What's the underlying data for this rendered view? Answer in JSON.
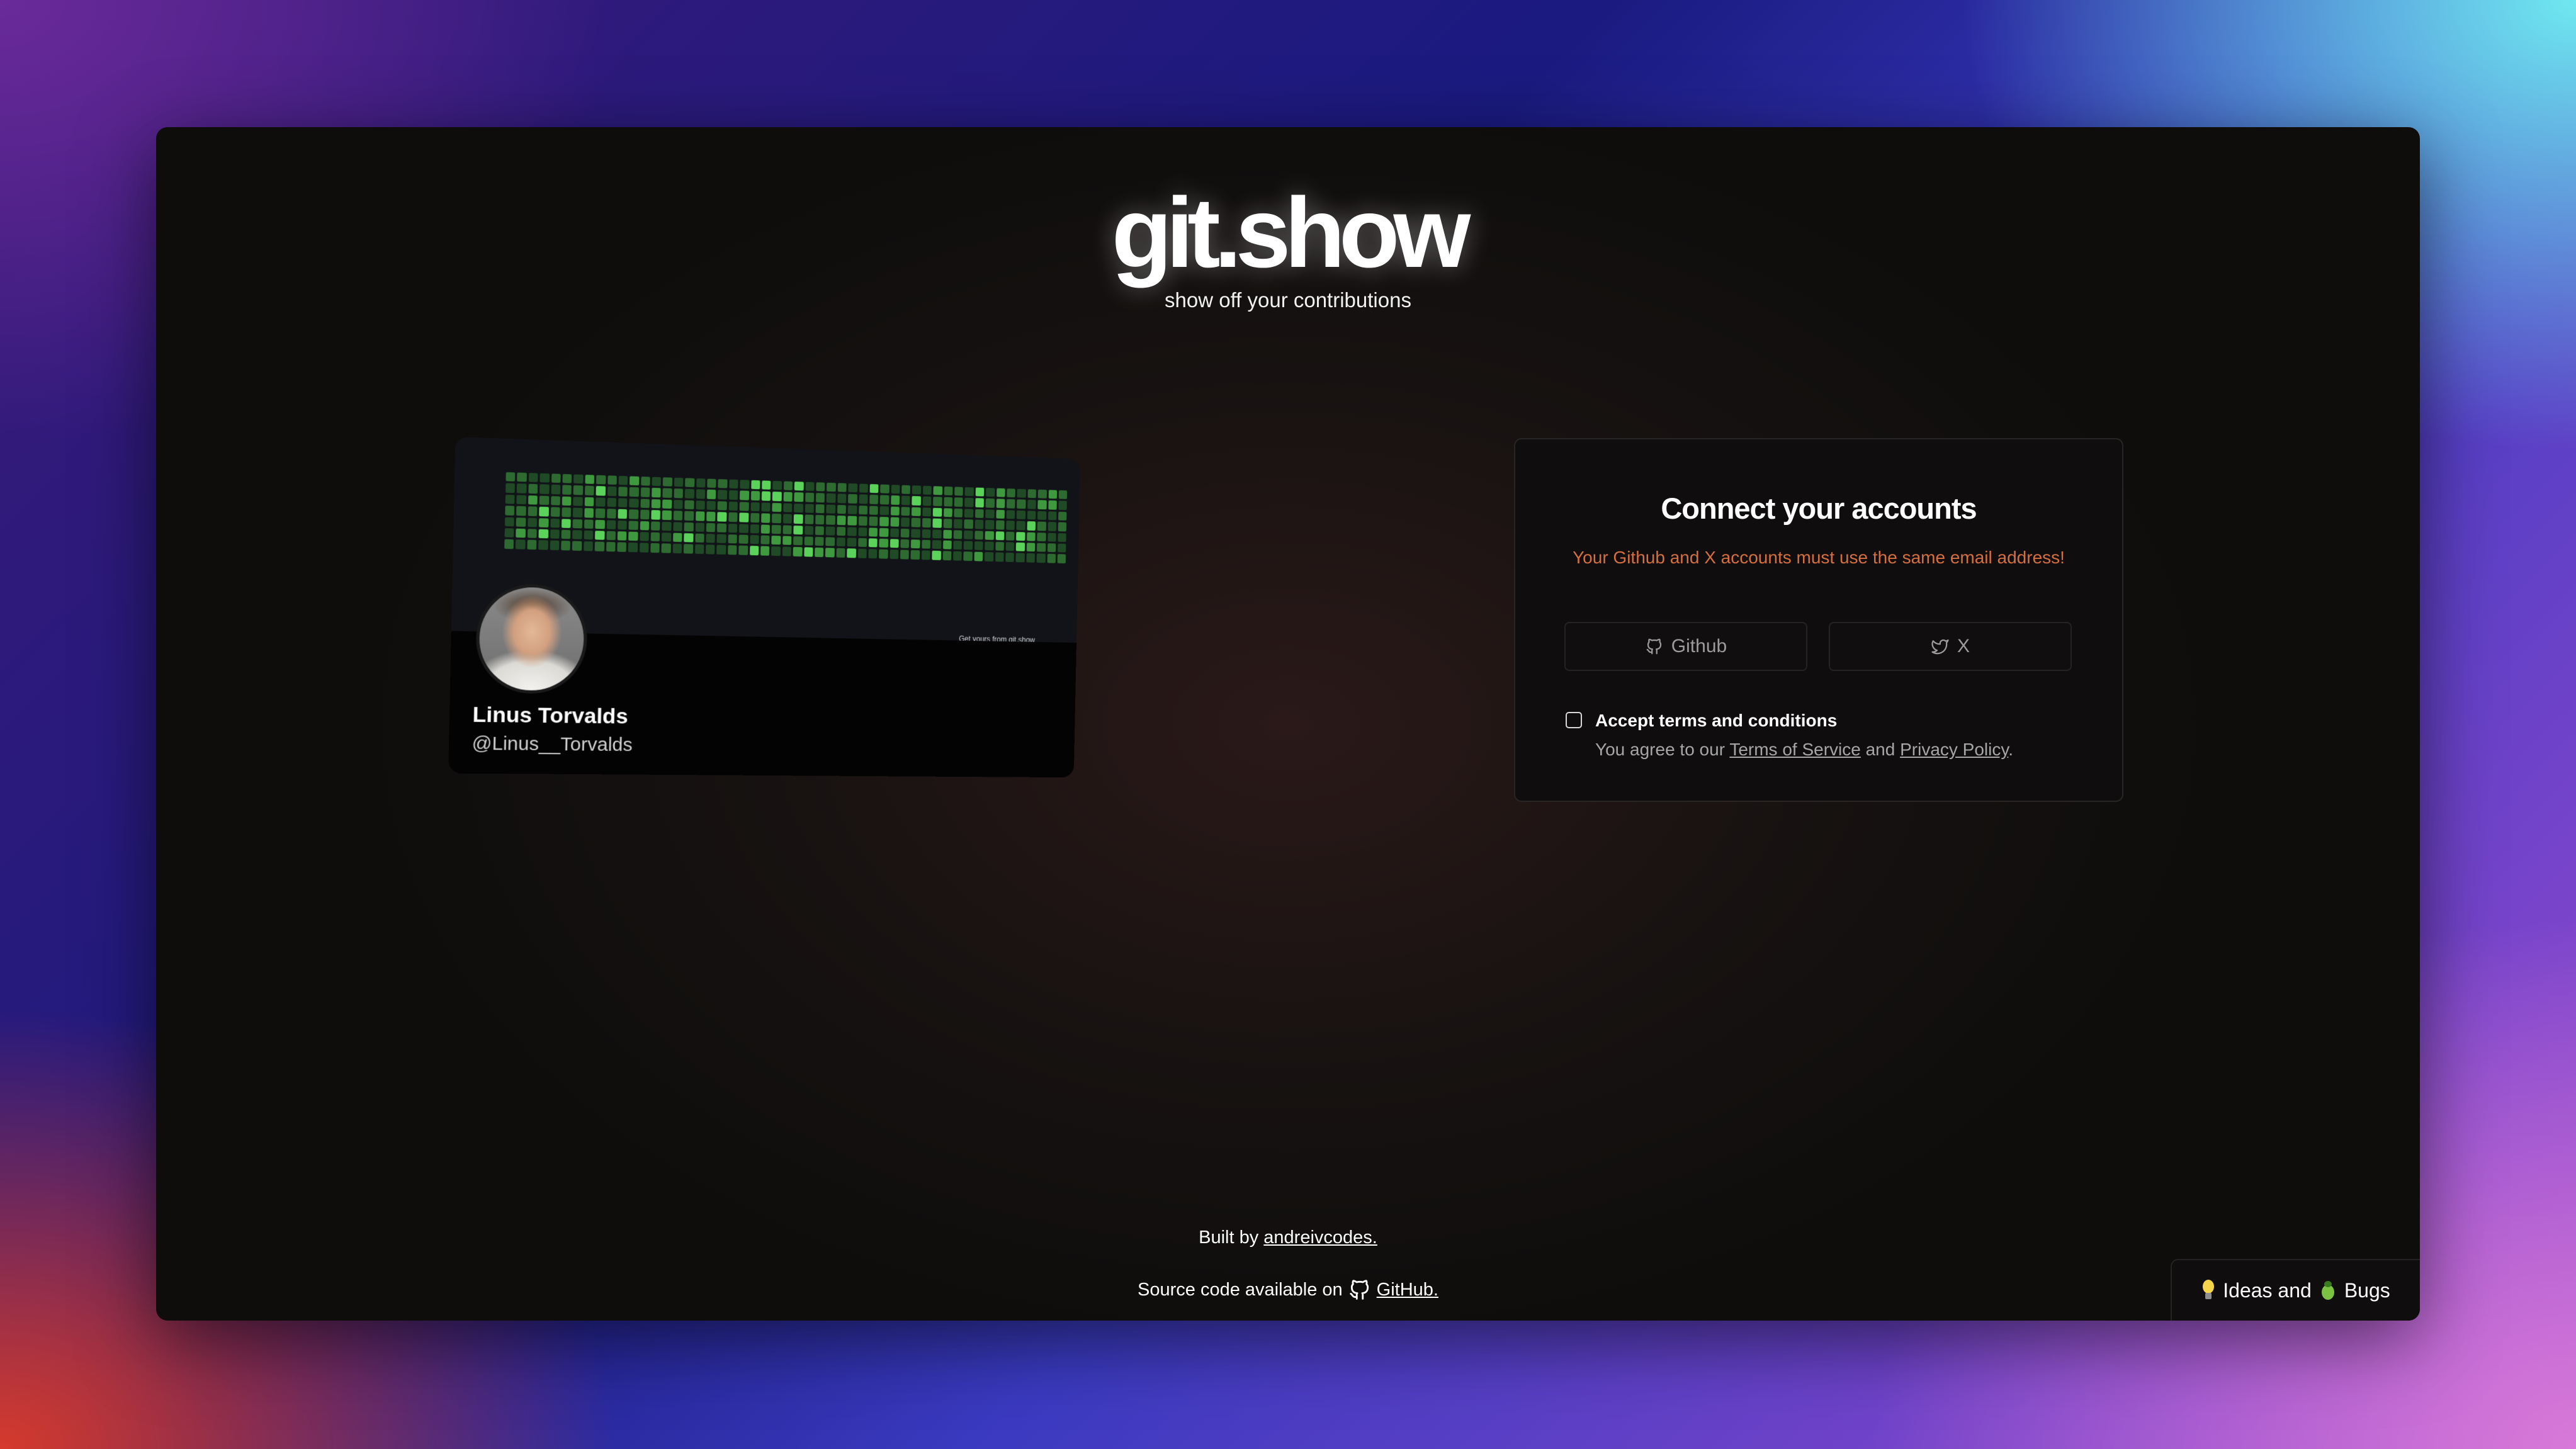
{
  "hero": {
    "title": "git.show",
    "subtitle": "show off your contributions"
  },
  "card": {
    "name": "Linus Torvalds",
    "handle": "@Linus__Torvalds",
    "get_yours": "Get yours from git.show",
    "contribution_colors": [
      "#162a1a",
      "#1f4a25",
      "#2d6b30",
      "#3f9a3f",
      "#5bd35a"
    ]
  },
  "connect": {
    "title": "Connect your accounts",
    "warning": "Your Github and X accounts must use the same email address!",
    "github_button": "Github",
    "x_button": "X",
    "terms_label": "Accept terms and conditions",
    "terms_prefix": "You agree to our",
    "terms_of_service": "Terms of Service",
    "terms_and": "and",
    "privacy_policy": "Privacy Policy",
    "terms_suffix": "."
  },
  "footer": {
    "built_by": "Built by",
    "author": "andreivcodes.",
    "source_prefix": "Source code available on",
    "source_link": "GitHub.",
    "ideas": "Ideas and",
    "bugs": "Bugs"
  },
  "colors": {
    "warning": "#d56f3e",
    "contribution_bright": "#5bd35a"
  },
  "icons": [
    "github-icon",
    "x-twitter-icon",
    "lightbulb-icon",
    "bug-icon"
  ]
}
